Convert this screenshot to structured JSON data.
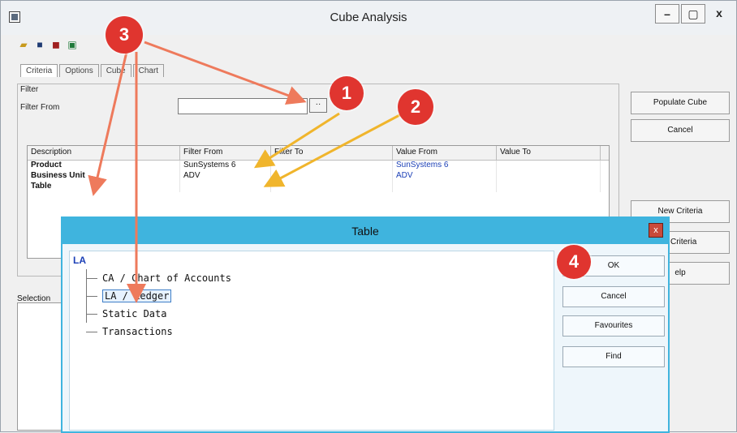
{
  "window": {
    "title": "Cube Analysis",
    "controls": [
      "–",
      "▢",
      "x"
    ]
  },
  "toolbar": {
    "icons": [
      "folder-open-icon",
      "save-icon",
      "binoculars-icon",
      "excel-icon"
    ]
  },
  "tabs": [
    {
      "label": "Criteria",
      "active": true
    },
    {
      "label": "Options"
    },
    {
      "label": "Cube"
    },
    {
      "label": "Chart"
    }
  ],
  "filter": {
    "group_label": "Filter",
    "filter_from_label": "Filter From",
    "filter_from_value": "",
    "ellipsis": "··"
  },
  "grid": {
    "columns": [
      "Description",
      "Filter From",
      "Filter To",
      "Value From",
      "Value To"
    ],
    "rows": [
      {
        "description": "Product",
        "filter_from": "SunSystems 6",
        "filter_to": "",
        "value_from": "SunSystems 6",
        "value_to": ""
      },
      {
        "description": "Business Unit",
        "filter_from": "ADV",
        "filter_to": "",
        "value_from": "ADV",
        "value_to": ""
      },
      {
        "description": "Table",
        "filter_from": "",
        "filter_to": "",
        "value_from": "",
        "value_to": ""
      }
    ]
  },
  "right_buttons": {
    "populate": "Populate Cube",
    "cancel": "Cancel",
    "new_criteria": "New Criteria",
    "save_criteria": "e Criteria",
    "help": "elp"
  },
  "selection_label": "Selection",
  "dialog": {
    "title": "Table",
    "close": "x",
    "heading": "LA",
    "tree": [
      {
        "label": "CA / Chart of Accounts"
      },
      {
        "label": "LA / Ledger",
        "selected": true
      },
      {
        "label": "Static Data"
      },
      {
        "label": "Transactions"
      }
    ],
    "buttons": {
      "ok": "OK",
      "cancel": "Cancel",
      "favourites": "Favourites",
      "find": "Find"
    }
  },
  "annotations": [
    "1",
    "2",
    "3",
    "4"
  ],
  "colors": {
    "dialog_accent": "#3fb4de",
    "badge": "#e0352f",
    "arrow_salmon": "#ee7a5c",
    "arrow_yellow": "#f0b52c",
    "link_blue": "#1b3fb6"
  }
}
